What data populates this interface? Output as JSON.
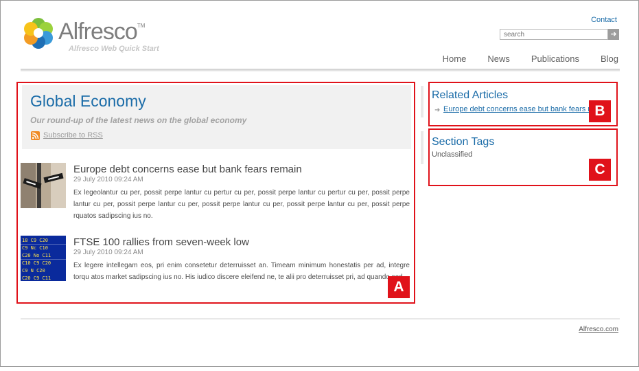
{
  "header": {
    "logo_word": "Alfresco",
    "logo_tm": "TM",
    "tagline": "Alfresco Web Quick Start",
    "contact_label": "Contact",
    "search_placeholder": "search",
    "search_button": "➜",
    "nav": [
      "Home",
      "News",
      "Publications",
      "Blog"
    ]
  },
  "section": {
    "title": "Global Economy",
    "subtitle": "Our round-up of the latest news on the global economy",
    "rss_label": "Subscribe to RSS",
    "articles": [
      {
        "title": "Europe debt concerns ease but bank fears remain",
        "date": "29 July 2010 09:24 AM",
        "body": "Ex legeolantur cu per, possit perpe lantur cu pertur cu per, possit perpe lantur cu pertur cu per, possit perpe lantur cu per, possit perpe lantur cu per, possit perpe lantur cu per, possit perpe lantur cu per, possit perpe rquatos sadipscing ius no."
      },
      {
        "title": "FTSE 100 rallies from seven-week low",
        "date": "29 July 2010 09:24 AM",
        "body": "Ex legere intellegam eos, pri enim consetetur deterruisset an. Timeam minimum honestatis per ad, integre torqu atos market sadipscing ius no. His iudico discere eleifend ne, te alii pro deterruisset pri, ad quando sed."
      }
    ]
  },
  "related": {
    "title": "Related Articles",
    "link": "Europe debt concerns ease but bank fears remain"
  },
  "tags": {
    "title": "Section Tags",
    "value": "Unclassified"
  },
  "labels": {
    "a": "A",
    "b": "B",
    "c": "C"
  },
  "footer": {
    "text": "Alfresco.com"
  },
  "colors": {
    "link": "#1b6ca8",
    "annotation": "#e0121a",
    "rss": "#f08a24"
  },
  "icons": {
    "logo": "alfresco-flower-logo",
    "rss": "rss-icon",
    "search": "arrow-right-icon",
    "related": "arrow-right-icon"
  }
}
